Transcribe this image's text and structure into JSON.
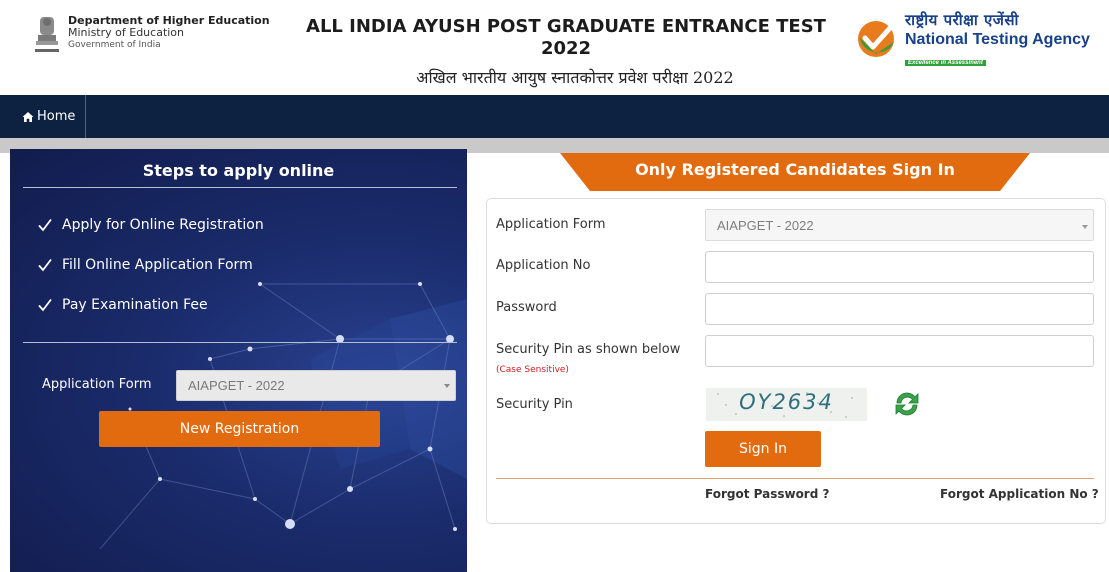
{
  "header": {
    "dept_line1": "Department of Higher Education",
    "dept_line2": "Ministry of Education",
    "dept_line3": "Government of India",
    "exam_title_line1": "ALL INDIA AYUSH POST GRADUATE ENTRANCE TEST",
    "exam_title_line2": "2022",
    "exam_title_hindi": "अखिल भारतीय आयुष स्नातकोत्तर प्रवेश परीक्षा 2022",
    "nta_hindi": "राष्ट्रीय परीक्षा एजेंसी",
    "nta_english": "National Testing Agency",
    "nta_tagline": "Excellence in Assessment"
  },
  "nav": {
    "home_label": "Home"
  },
  "left_panel": {
    "title": "Steps to apply online",
    "steps": [
      "Apply for Online Registration",
      "Fill Online Application Form",
      "Pay Examination Fee"
    ],
    "application_form_label": "Application Form",
    "application_form_value": "AIAPGET - 2022",
    "new_registration_label": "New Registration"
  },
  "right_panel": {
    "title": "Only Registered Candidates Sign In",
    "application_form_label": "Application Form",
    "application_form_value": "AIAPGET - 2022",
    "application_no_label": "Application No",
    "password_label": "Password",
    "security_pin_input_label": "Security Pin as shown below",
    "case_sensitive_note": "(Case Sensitive)",
    "security_pin_label": "Security Pin",
    "captcha_text": "OY2634",
    "sign_in_label": "Sign In",
    "forgot_password_label": "Forgot Password ?",
    "forgot_application_no_label": "Forgot Application No ?"
  },
  "colors": {
    "navbar": "#0d2240",
    "accent_orange": "#e26b10",
    "nta_blue": "#17418b",
    "nta_green": "#2f9e3b",
    "caution_red": "#cc1f1f"
  },
  "icons": [
    "emblem-icon",
    "home-icon",
    "check-icon",
    "nta-logo-icon",
    "refresh-icon",
    "dropdown-caret-icon"
  ]
}
